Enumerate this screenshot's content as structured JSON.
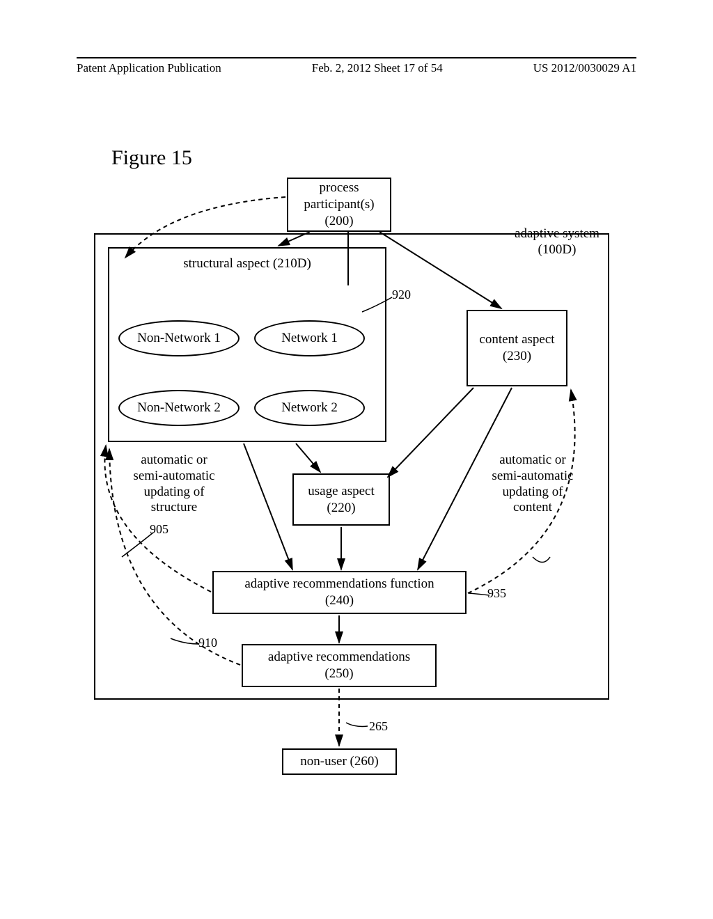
{
  "header": {
    "left": "Patent Application Publication",
    "center": "Feb. 2, 2012  Sheet 17 of 54",
    "right": "US 2012/0030029 A1"
  },
  "figure_title": "Figure 15",
  "boxes": {
    "process_participants": "process\nparticipant(s)\n(200)",
    "structural_aspect": "structural aspect (210D)",
    "content_aspect": "content aspect\n(230)",
    "usage_aspect": "usage aspect\n(220)",
    "adaptive_rec_function": "adaptive recommendations function\n(240)",
    "adaptive_recommendations": "adaptive recommendations\n(250)",
    "non_user": "non-user (260)"
  },
  "ellipses": {
    "nonnet1": "Non-Network 1",
    "net1": "Network 1",
    "nonnet2": "Non-Network 2",
    "net2": "Network 2"
  },
  "labels": {
    "adaptive_system": "adaptive system\n(100D)",
    "update_structure": "automatic or\nsemi-automatic\nupdating of\nstructure",
    "update_content": "automatic or\nsemi-automatic\nupdating of\ncontent",
    "n920": "920",
    "n905": "905",
    "n910": "910",
    "n935": "935",
    "n265": "265"
  }
}
